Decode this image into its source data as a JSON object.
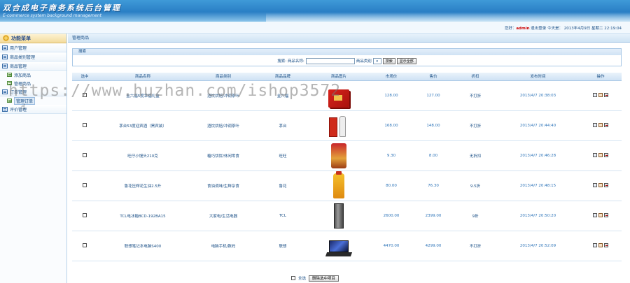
{
  "header": {
    "title": "双合成电子商务系统后台管理",
    "subtitle": "E-commerce system background management"
  },
  "status": {
    "greeting": "您好：",
    "user": "admin",
    "logout": "退出登录",
    "today_label": "今天是：",
    "date": "2013年4月9日 星期二 22:19:04"
  },
  "sidebar": {
    "title": "功能菜单",
    "items": [
      {
        "label": "用户管理"
      },
      {
        "label": "商品类别管理"
      },
      {
        "label": "商品管理"
      },
      {
        "label": "订单管理"
      },
      {
        "label": "评价管理"
      }
    ],
    "product_sub": [
      {
        "label": "添加商品"
      },
      {
        "label": "管理商品"
      }
    ],
    "order_sub": [
      {
        "label": "管理订单"
      }
    ]
  },
  "breadcrumb": "管理商品",
  "search": {
    "title": "搜索",
    "label": "搜索: 商品名称:",
    "category_label": "商品类别",
    "search_button": "搜索",
    "show_all_button": "显示全部"
  },
  "table": {
    "headers": [
      "选中",
      "商品名称",
      "商品类别",
      "商品品牌",
      "商品图片",
      "市场价",
      "售价",
      "折扣",
      "发布时间",
      "操作"
    ],
    "rows": [
      {
        "name": "金六福5度幸福礼盒",
        "category": "酒饮烘焙/冲调茶叶",
        "brand": "金六福",
        "picture": "gift-box",
        "market": "128.00",
        "price": "127.00",
        "discount": "不打折",
        "time": "2013/4/7 20:38:03"
      },
      {
        "name": "茅台53度迎宾酒（黑宾装）",
        "category": "酒饮烘焙/冲调茶叶",
        "brand": "茅台",
        "picture": "liquor",
        "market": "168.00",
        "price": "148.00",
        "discount": "不打折",
        "time": "2013/4/7 20:44:40"
      },
      {
        "name": "旺仔小馒头210克",
        "category": "糖巧饼饼/休闲零食",
        "brand": "旺旺",
        "picture": "snack-bag",
        "market": "9.30",
        "price": "8.00",
        "discount": "无折扣",
        "time": "2013/4/7 20:46:28"
      },
      {
        "name": "鲁花压榨花生油2.5升",
        "category": "食油调味/生鲜杂食",
        "brand": "鲁花",
        "picture": "oil-bottle",
        "market": "80.00",
        "price": "76.30",
        "discount": "9.5折",
        "time": "2013/4/7 20:48:15"
      },
      {
        "name": "TCL电冰箱BCD-192BA15",
        "category": "大家电/生活电器",
        "brand": "TCL",
        "picture": "fridge",
        "market": "2600.00",
        "price": "2399.00",
        "discount": "9折",
        "time": "2013/4/7 20:50:20"
      },
      {
        "name": "联想笔记本电脑S400",
        "category": "电脑手机/数码",
        "brand": "联想",
        "picture": "laptop",
        "market": "4470.00",
        "price": "4299.00",
        "discount": "不打折",
        "time": "2013/4/7 20:52:09"
      }
    ]
  },
  "footer": {
    "select_all": "全选",
    "delete_button": "删除选中项目"
  },
  "watermark": "https://www.huzhan.com/ishop3572"
}
